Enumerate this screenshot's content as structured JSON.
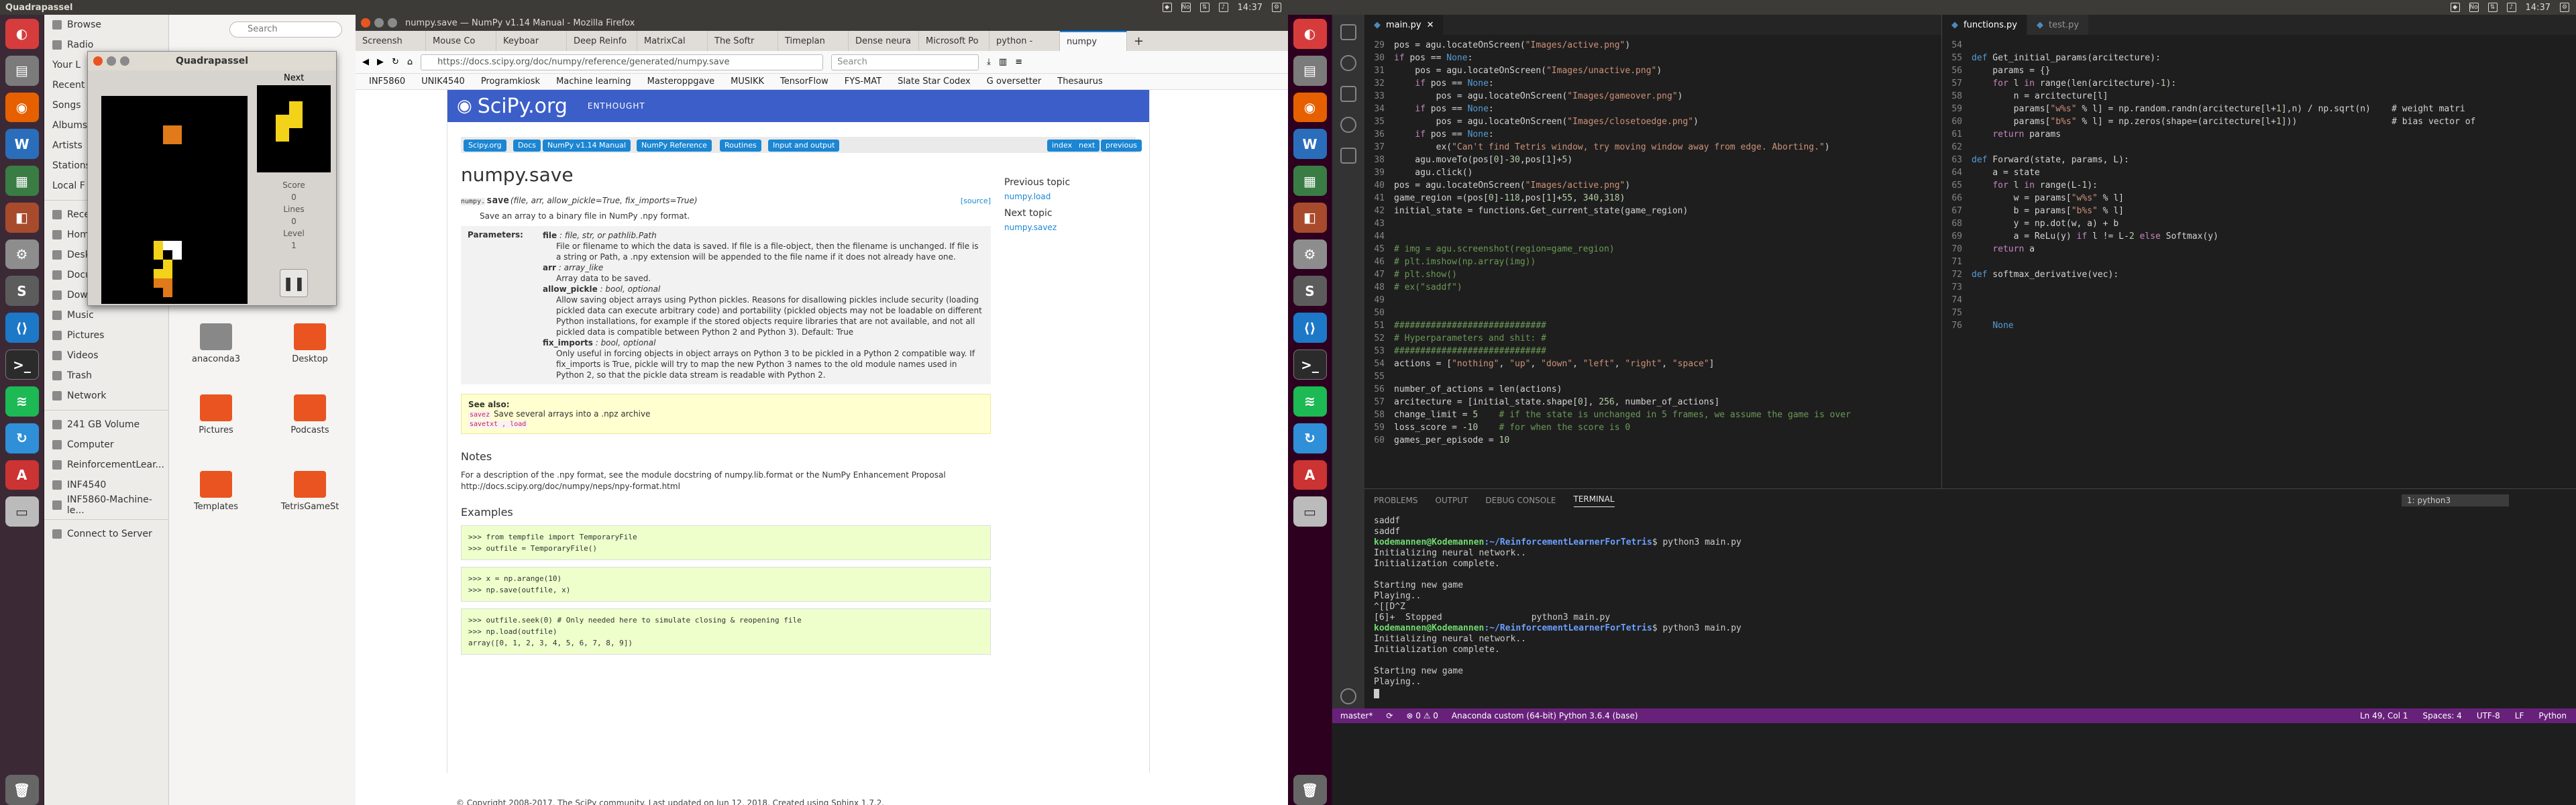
{
  "screen1": {
    "topbar": {
      "title": "Quadrapassel",
      "clock": "14:37"
    },
    "nautilus": {
      "sidebar": [
        "Browse",
        "Radio",
        "Your L",
        "Recent",
        "Songs",
        "Albums",
        "Artists",
        "Stations",
        "Local F",
        "Recent",
        "Home",
        "Desktop",
        "Documents",
        "Downloads",
        "Music",
        "Pictures",
        "Videos",
        "Trash",
        "Network",
        "241 GB Volume",
        "Computer",
        "ReinforcementLear...",
        "INF4540",
        "INF5860-Machine-le...",
        "Connect to Server"
      ],
      "search_placeholder": "Search",
      "folders": [
        "anaconda3",
        "Desktop",
        "Pictures",
        "Podcasts",
        "Templates",
        "TetrisGameSt"
      ]
    },
    "tetris": {
      "title": "Quadrapassel",
      "next_label": "Next",
      "score_label": "Score",
      "score": "0",
      "lines_label": "Lines",
      "lines": "0",
      "level_label": "Level",
      "level": "1"
    },
    "firefox": {
      "window_title": "numpy.save — NumPy v1.14 Manual - Mozilla Firefox",
      "tabs": [
        "Screensh",
        "Mouse Co",
        "Keyboar",
        "Deep Reinfo",
        "MatrixCal",
        "The Softr",
        "Timeplan",
        "Dense neura",
        "Microsoft Po",
        "python -",
        "numpy"
      ],
      "url": "https://docs.scipy.org/doc/numpy/reference/generated/numpy.save",
      "search_placeholder": "Search",
      "bookmarks": [
        "INF5860",
        "UNIK4540",
        "Programkiosk",
        "Machine learning",
        "Masteroppgave",
        "MUSIKK",
        "TensorFlow",
        "FYS-MAT",
        "Slate Star Codex",
        "G oversetter",
        "Thesaurus"
      ],
      "page": {
        "banner": "SciPy.org",
        "banner_sub": "ENTHOUGHT",
        "breadcrumbs": [
          "Scipy.org",
          "Docs",
          "NumPy v1.14 Manual",
          "NumPy Reference",
          "Routines",
          "Input and output"
        ],
        "nav_right": [
          "index",
          "next",
          "previous"
        ],
        "h1": "numpy.save",
        "signature_prefix": "numpy.",
        "signature_name": "save",
        "signature_args": "(file, arr, allow_pickle=True, fix_imports=True)",
        "source": "[source]",
        "summary": "Save an array to a binary file in NumPy .npy format.",
        "params_label": "Parameters:",
        "params": [
          {
            "name": "file",
            "type": " : file, str, or pathlib.Path",
            "desc": "File or filename to which the data is saved. If file is a file-object, then the filename is unchanged. If file is a string or Path, a .npy extension will be appended to the file name if it does not already have one."
          },
          {
            "name": "arr",
            "type": " : array_like",
            "desc": "Array data to be saved."
          },
          {
            "name": "allow_pickle",
            "type": " : bool, optional",
            "desc": "Allow saving object arrays using Python pickles. Reasons for disallowing pickles include security (loading pickled data can execute arbitrary code) and portability (pickled objects may not be loadable on different Python installations, for example if the stored objects require libraries that are not available, and not all pickled data is compatible between Python 2 and Python 3). Default: True"
          },
          {
            "name": "fix_imports",
            "type": " : bool, optional",
            "desc": "Only useful in forcing objects in object arrays on Python 3 to be pickled in a Python 2 compatible way. If fix_imports is True, pickle will try to map the new Python 3 names to the old module names used in Python 2, so that the pickle data stream is readable with Python 2."
          }
        ],
        "see_also_label": "See also:",
        "see_also_1": "savez",
        "see_also_1_desc": "Save several arrays into a .npz archive",
        "see_also_2": "savetxt , load",
        "notes_h": "Notes",
        "notes_text": "For a description of the .npy format, see the module docstring of numpy.lib.format or the NumPy Enhancement Proposal http://docs.scipy.org/doc/numpy/neps/npy-format.html",
        "examples_h": "Examples",
        "code1": [
          ">>> from tempfile import TemporaryFile",
          ">>> outfile = TemporaryFile()"
        ],
        "code2": [
          ">>> x = np.arange(10)",
          ">>> np.save(outfile, x)"
        ],
        "code3": [
          ">>> outfile.seek(0) # Only needed here to simulate closing & reopening file",
          ">>> np.load(outfile)",
          "array([0, 1, 2, 3, 4, 5, 6, 7, 8, 9])"
        ],
        "prev_topic_h": "Previous topic",
        "prev_topic": "numpy.load",
        "next_topic_h": "Next topic",
        "next_topic": "numpy.savez",
        "footer": "© Copyright 2008-2017, The SciPy community.    Last updated on Jun 12, 2018.    Created using Sphinx 1.7.2."
      }
    }
  },
  "screen2": {
    "topbar": {
      "clock": "14:37"
    },
    "editor_left": {
      "tab": "main.py",
      "lines": [
        {
          "n": "29",
          "t": "pos = agu.locateOnScreen(\"Images/active.png\")"
        },
        {
          "n": "30",
          "t": "if pos == None:"
        },
        {
          "n": "31",
          "t": "    pos = agu.locateOnScreen(\"Images/unactive.png\")"
        },
        {
          "n": "32",
          "t": "    if pos == None:"
        },
        {
          "n": "33",
          "t": "        pos = agu.locateOnScreen(\"Images/gameover.png\")"
        },
        {
          "n": "34",
          "t": "    if pos == None:"
        },
        {
          "n": "35",
          "t": "        pos = agu.locateOnScreen(\"Images/closetoedge.png\")"
        },
        {
          "n": "36",
          "t": "    if pos == None:"
        },
        {
          "n": "37",
          "t": "        ex(\"Can't find Tetris window, try moving window away from edge. Aborting.\")"
        },
        {
          "n": "38",
          "t": "    agu.moveTo(pos[0]-30,pos[1]+5)"
        },
        {
          "n": "39",
          "t": "    agu.click()"
        },
        {
          "n": "40",
          "t": "pos = agu.locateOnScreen(\"Images/active.png\")"
        },
        {
          "n": "41",
          "t": "game_region =(pos[0]-118,pos[1]+55, 340,318)"
        },
        {
          "n": "42",
          "t": "initial_state = functions.Get_current_state(game_region)"
        },
        {
          "n": "43",
          "t": ""
        },
        {
          "n": "44",
          "t": ""
        },
        {
          "n": "45",
          "t": "# img = agu.screenshot(region=game_region)"
        },
        {
          "n": "46",
          "t": "# plt.imshow(np.array(img))"
        },
        {
          "n": "47",
          "t": "# plt.show()"
        },
        {
          "n": "48",
          "t": "# ex(\"saddf\")"
        },
        {
          "n": "49",
          "t": ""
        },
        {
          "n": "50",
          "t": ""
        },
        {
          "n": "51",
          "t": "#############################"
        },
        {
          "n": "52",
          "t": "# Hyperparameters and shit: #"
        },
        {
          "n": "53",
          "t": "#############################"
        },
        {
          "n": "54",
          "t": "actions = [\"nothing\", \"up\", \"down\", \"left\", \"right\", \"space\"]"
        },
        {
          "n": "55",
          "t": ""
        },
        {
          "n": "56",
          "t": "number_of_actions = len(actions)"
        },
        {
          "n": "57",
          "t": "arcitecture = [initial_state.shape[0], 256, number_of_actions]"
        },
        {
          "n": "58",
          "t": "change_limit = 5    # if the state is unchanged in 5 frames, we assume the game is over"
        },
        {
          "n": "59",
          "t": "loss_score = -10    # for when the score is 0"
        },
        {
          "n": "60",
          "t": "games_per_episode = 10"
        }
      ]
    },
    "editor_right": {
      "tab": "functions.py",
      "tab2": "test.py",
      "lines": [
        {
          "n": "54",
          "t": ""
        },
        {
          "n": "55",
          "t": "def Get_initial_params(arcitecture):"
        },
        {
          "n": "56",
          "t": "    params = {}"
        },
        {
          "n": "57",
          "t": "    for l in range(len(arcitecture)-1):"
        },
        {
          "n": "58",
          "t": "        n = arcitecture[l]"
        },
        {
          "n": "59",
          "t": "        params[\"w%s\" % l] = np.random.randn(arcitecture[l+1],n) / np.sqrt(n)    # weight matri"
        },
        {
          "n": "60",
          "t": "        params[\"b%s\" % l] = np.zeros(shape=(arcitecture[l+1]))                  # bias vector of"
        },
        {
          "n": "61",
          "t": "    return params"
        },
        {
          "n": "62",
          "t": ""
        },
        {
          "n": "63",
          "t": "def Forward(state, params, L):"
        },
        {
          "n": "64",
          "t": "    a = state"
        },
        {
          "n": "65",
          "t": "    for l in range(L-1):"
        },
        {
          "n": "66",
          "t": "        w = params[\"w%s\" % l]"
        },
        {
          "n": "67",
          "t": "        b = params[\"b%s\" % l]"
        },
        {
          "n": "68",
          "t": "        y = np.dot(w, a) + b"
        },
        {
          "n": "69",
          "t": "        a = ReLu(y) if l != L-2 else Softmax(y)"
        },
        {
          "n": "70",
          "t": "    return a"
        },
        {
          "n": "71",
          "t": ""
        },
        {
          "n": "72",
          "t": "def softmax_derivative(vec):"
        },
        {
          "n": "73",
          "t": ""
        },
        {
          "n": "74",
          "t": ""
        },
        {
          "n": "75",
          "t": ""
        },
        {
          "n": "76",
          "t": "    None"
        }
      ]
    },
    "panel": {
      "tabs": [
        "PROBLEMS",
        "OUTPUT",
        "DEBUG CONSOLE",
        "TERMINAL"
      ],
      "terminal_select": "1: python3",
      "terminal": [
        {
          "t": "plain",
          "s": "saddf"
        },
        {
          "t": "plain",
          "s": "saddf"
        },
        {
          "t": "prompt",
          "user": "kodemannen@Kodemannen",
          "path": ":~/ReinforcementLearnerForTetris",
          "cmd": "$ python3 main.py"
        },
        {
          "t": "plain",
          "s": "Initializing neural network.."
        },
        {
          "t": "plain",
          "s": "Initialization complete."
        },
        {
          "t": "plain",
          "s": ""
        },
        {
          "t": "plain",
          "s": "Starting new game"
        },
        {
          "t": "plain",
          "s": "Playing.."
        },
        {
          "t": "plain",
          "s": "^[[D^Z"
        },
        {
          "t": "plain",
          "s": "[6]+  Stopped                 python3 main.py"
        },
        {
          "t": "prompt",
          "user": "kodemannen@Kodemannen",
          "path": ":~/ReinforcementLearnerForTetris",
          "cmd": "$ python3 main.py"
        },
        {
          "t": "plain",
          "s": "Initializing neural network.."
        },
        {
          "t": "plain",
          "s": "Initialization complete."
        },
        {
          "t": "plain",
          "s": ""
        },
        {
          "t": "plain",
          "s": "Starting new game"
        },
        {
          "t": "plain",
          "s": "Playing.."
        }
      ]
    },
    "statusbar": {
      "branch": "master*",
      "sync": "⟳",
      "problems": "⊗ 0 ⚠ 0",
      "interpreter": "Anaconda custom (64-bit) Python 3.6.4 (base)",
      "position": "Ln 49, Col 1",
      "spaces": "Spaces: 4",
      "encoding": "UTF-8",
      "eol": "LF",
      "language": "Python"
    }
  },
  "colors": {
    "ubuntu_purple": "#2c001e",
    "tetris_orange": "#e07a1a",
    "tetris_yellow": "#f3d21a",
    "scipy_blue": "#3b5ec8",
    "vscode_status": "#68217a"
  }
}
